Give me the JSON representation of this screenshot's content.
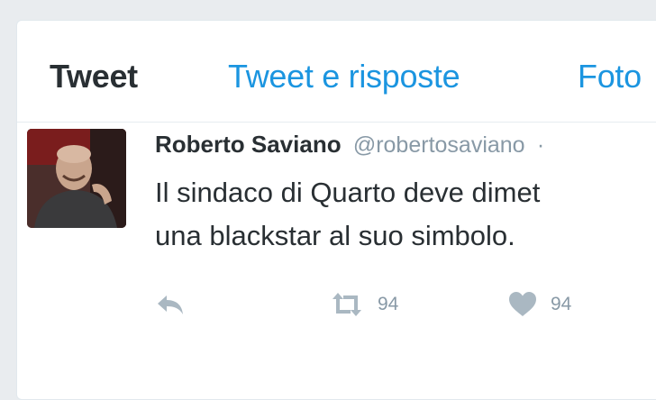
{
  "tabs": [
    {
      "label": "Tweet"
    },
    {
      "label": "Tweet e risposte"
    },
    {
      "label": "Foto"
    }
  ],
  "tweet": {
    "author_name": "Roberto Saviano",
    "author_handle": "@robertosaviano",
    "separator": "·",
    "text_lines": [
      "Il sindaco di Quarto deve dimet",
      "una blackstar al suo simbolo."
    ],
    "retweet_count": "94",
    "like_count": "94"
  },
  "colors": {
    "accent": "#1b95e0",
    "text": "#292f33",
    "muted": "#8899a6",
    "icon": "#aab8c2"
  },
  "icons": {
    "reply": "reply-icon",
    "retweet": "retweet-icon",
    "like": "heart-icon"
  }
}
